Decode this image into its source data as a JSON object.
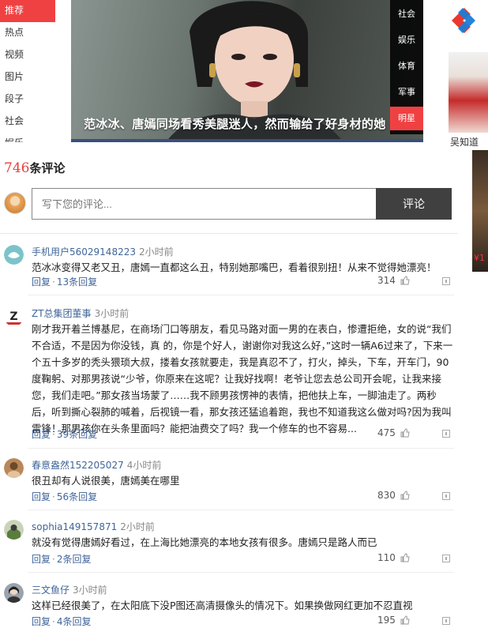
{
  "nav": {
    "items": [
      "推荐",
      "热点",
      "视频",
      "图片",
      "段子",
      "社会",
      "娱乐"
    ],
    "active_index": 0
  },
  "hero": {
    "caption": "范冰冰、唐嫣同场看秀美腿迷人，然而输给了好身材的她",
    "tabs": [
      "社会",
      "娱乐",
      "体育",
      "军事",
      "明星"
    ],
    "active_tab": "明星"
  },
  "right_ads": {
    "text": "吴知道",
    "price": "¥1"
  },
  "comments_header": {
    "count": "746",
    "label": "条评论"
  },
  "composer": {
    "placeholder": "写下您的评论...",
    "submit": "评论"
  },
  "comments": [
    {
      "user": "手机用户56029148223",
      "time": "2小时前",
      "text": "范冰冰变得又老又丑，唐嫣一直都这么丑，特别她那嘴巴，看着很别扭！从来不觉得她漂亮！",
      "reply": "回复",
      "replies": "13条回复",
      "likes": "314"
    },
    {
      "user": "ZT总集团董事",
      "time": "3小时前",
      "text": "刚才我开着兰博基尼，在商场门口等朋友，看见马路对面一男的在表白，惨遭拒绝，女的说“我们不合适，不是因为你没钱，真 的，你是个好人，谢谢你对我这么好，”这时一辆A6过来了，下来一个五十多岁的秃头猥琐大叔，搂着女孩就要走，我是真忍不了，打火，掉头，下车，开车门，90度鞠躬、对那男孩说“少爷，你原来在这呢？让我好找啊！老爷让您去总公司开会呢，让我来接您，我们走吧。”那女孩当场蒙了……我不顾男孩愣神的表情，把他扶上车，一脚油走了。两秒后，听到撕心裂肺的喊着，后视镜一看，那女孩还猛追着跑，我也不知道我这么做对吗?因为我叫雷锋！那男孩你在头条里面吗？能把油费交了吗？我一个修车的也不容易...",
      "reply": "回复",
      "replies": "39条回复",
      "likes": "475"
    },
    {
      "user": "春意盎然152205027",
      "time": "4小时前",
      "text": "很丑却有人说很美，唐嫣美在哪里",
      "reply": "回复",
      "replies": "56条回复",
      "likes": "830"
    },
    {
      "user": "sophia149157871",
      "time": "2小时前",
      "text": "就没有觉得唐嫣好看过，在上海比她漂亮的本地女孩有很多。唐嫣只是路人而已",
      "reply": "回复",
      "replies": "2条回复",
      "likes": "110"
    },
    {
      "user": "三文鱼仔",
      "time": "3小时前",
      "text": "这样已经很美了，在太阳底下没P图还高清摄像头的情况下。如果换做网红更加不忍直视",
      "reply": "回复",
      "replies": "4条回复",
      "likes": "195"
    }
  ],
  "colors": {
    "accent_red": "#f04142",
    "link_blue": "#406599",
    "count_red": "#e23f3f",
    "button_dark": "#404040"
  }
}
